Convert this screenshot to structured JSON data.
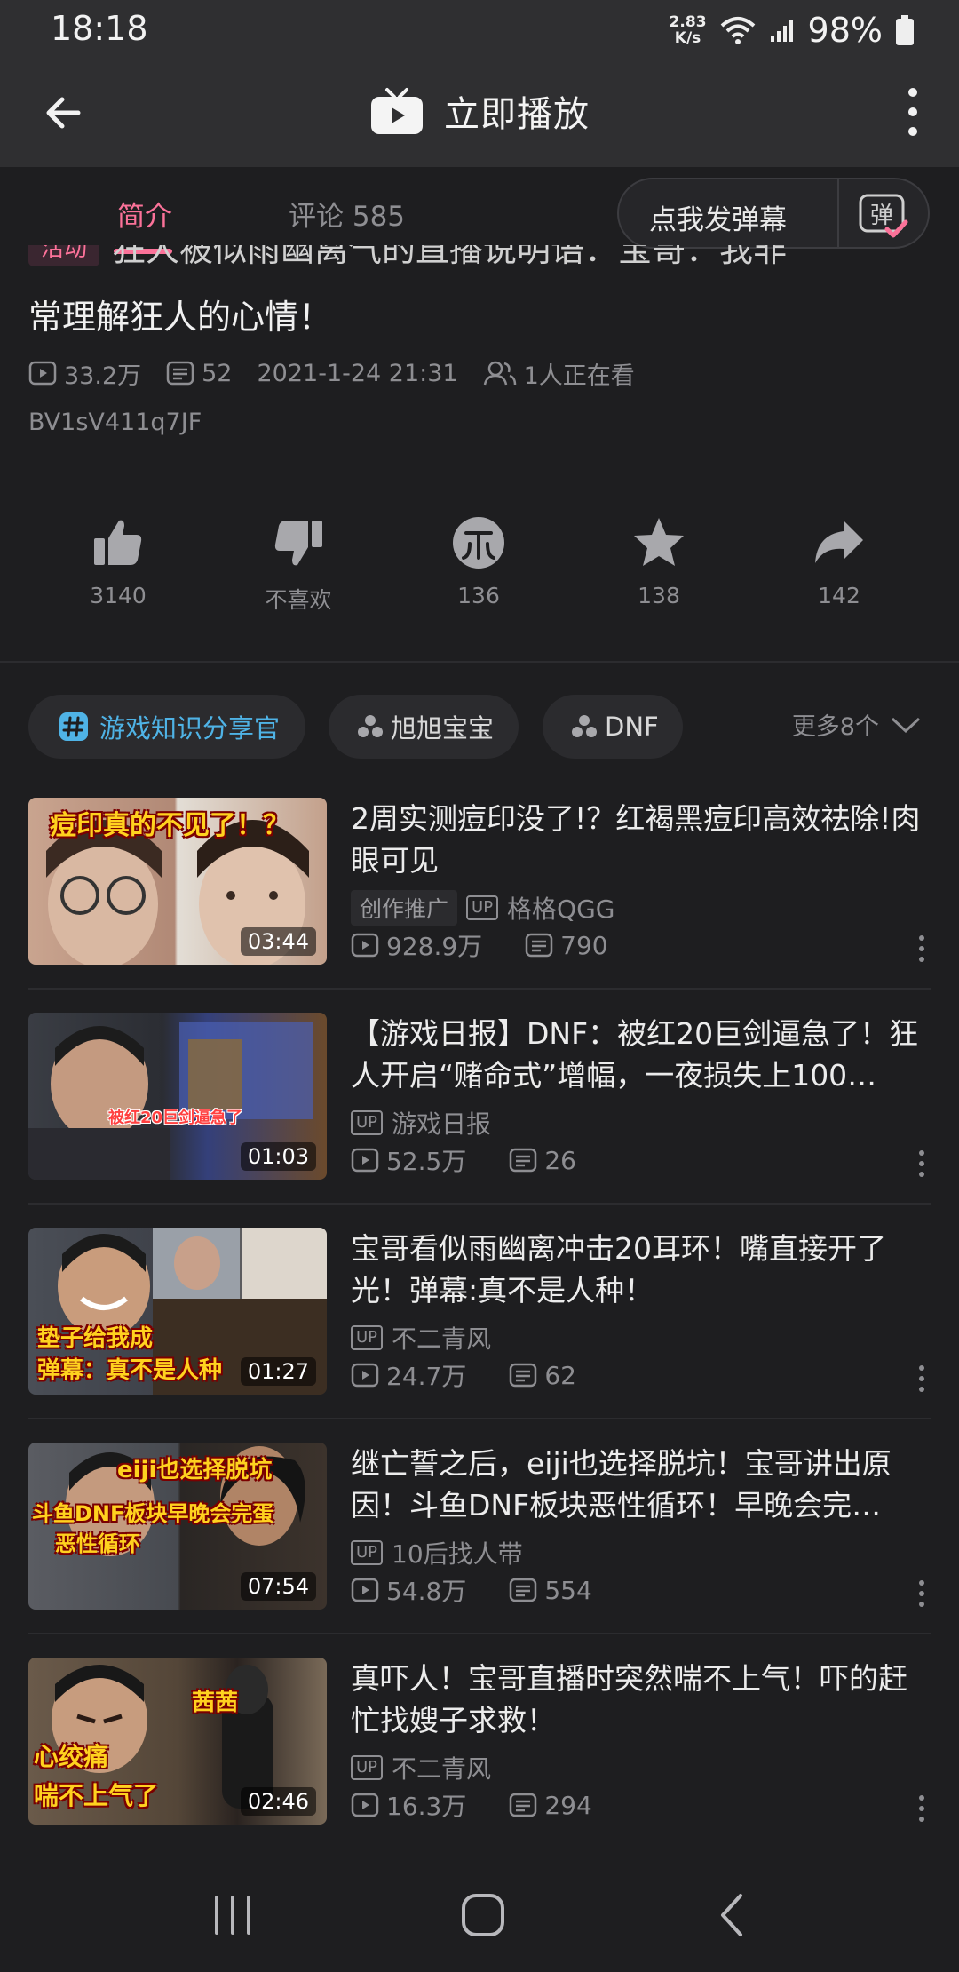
{
  "status_bar": {
    "time": "18:18",
    "net_speed_value": "2.83",
    "net_speed_unit": "K/s",
    "battery": "98%"
  },
  "top_bar": {
    "title": "立即播放"
  },
  "tabs": {
    "intro": "简介",
    "comments": "评论 585",
    "danmaku_button": "点我发弹幕"
  },
  "video": {
    "activity_tag": "活动",
    "title_clipped": "狂人被似雨幽离气的直播说明语：宝哥：我非",
    "title_line2": "常理解狂人的心情！",
    "views": "33.2万",
    "danmaku_count": "52",
    "date": "2021-1-24 21:31",
    "watching": "1人正在看",
    "bvid": "BV1sV411q7JF"
  },
  "actions": [
    {
      "name": "like",
      "label": "3140"
    },
    {
      "name": "dislike",
      "label": "不喜欢"
    },
    {
      "name": "coin",
      "label": "136"
    },
    {
      "name": "favorite",
      "label": "138"
    },
    {
      "name": "share",
      "label": "142"
    }
  ],
  "tags": {
    "items": [
      "游戏知识分享官",
      "旭旭宝宝",
      "DNF"
    ],
    "more": "更多8个"
  },
  "related": [
    {
      "title": "2周实测痘印没了!？红褐黑痘印高效祛除!肉眼可见",
      "promo": "创作推广",
      "uploader": "格格QGG",
      "views": "928.9万",
      "danmaku": "790",
      "duration": "03:44",
      "thumb_caption": "痘印真的不见了！？"
    },
    {
      "title": "【游戏日报】DNF：被红20巨剑逼急了！狂人开启“赌命式”增幅，一夜损失上100…",
      "uploader": "游戏日报",
      "views": "52.5万",
      "danmaku": "26",
      "duration": "01:03",
      "thumb_caption": "被红20巨剑逼急了"
    },
    {
      "title": "宝哥看似雨幽离冲击20耳环！嘴直接开了光！弹幕:真不是人种！",
      "uploader": "不二青风",
      "views": "24.7万",
      "danmaku": "62",
      "duration": "01:27",
      "thumb_caption": "垫子给我成",
      "thumb_caption2": "弹幕：真不是人种"
    },
    {
      "title": "继亡誓之后，eiji也选择脱坑！宝哥讲出原因！斗鱼DNF板块恶性循环！早晚会完…",
      "uploader": "10后找人带",
      "views": "54.8万",
      "danmaku": "554",
      "duration": "07:54",
      "thumb_caption": "eiji也选择脱坑",
      "thumb_caption2": "斗鱼DNF板块早晚会完蛋",
      "thumb_caption3": "恶性循环"
    },
    {
      "title": "真吓人！宝哥直播时突然喘不上气！吓的赶忙找嫂子求救！",
      "uploader": "不二青风",
      "views": "16.3万",
      "danmaku": "294",
      "duration": "02:46",
      "thumb_caption": "茜茜",
      "thumb_caption2": "心绞痛",
      "thumb_caption3": "喘不上气了"
    }
  ],
  "colors": {
    "accent_pink": "#fb7299",
    "topic_blue": "#4fb3e6",
    "background": "#1e1e20"
  }
}
